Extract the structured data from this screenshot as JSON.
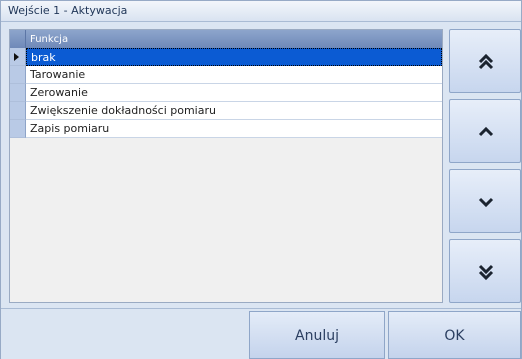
{
  "window": {
    "title": "Wejście 1 - Aktywacja"
  },
  "grid": {
    "header": "Funkcja",
    "rows": [
      "brak",
      "Tarowanie",
      "Zerowanie",
      "Zwiększenie dokładności pomiaru",
      "Zapis pomiaru"
    ],
    "selected_index": 0
  },
  "scroll_buttons": [
    "double-chevron-up-icon",
    "chevron-up-icon",
    "chevron-down-icon",
    "double-chevron-down-icon"
  ],
  "footer": {
    "cancel_label": "Anuluj",
    "ok_label": "OK"
  }
}
